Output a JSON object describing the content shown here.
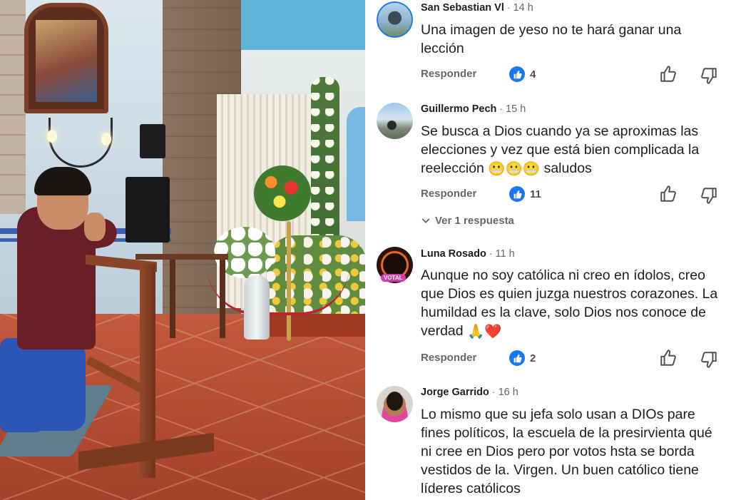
{
  "photo": {
    "description_icon": "photo-icon"
  },
  "comments": [
    {
      "author": "San Sebastian Vl",
      "time": "14 h",
      "text": "Una imagen de yeso no te hará ganar una lección",
      "reply_label": "Responder",
      "like_count": "4",
      "avatar_icon": "avatar-photo-icon"
    },
    {
      "author": "Guillermo Pech",
      "time": "15 h",
      "text_before": "Se busca a Dios cuando ya se aproximas las elecciones y vez que está bien complicada la reelección",
      "emojis": "😬😬😬",
      "text_after": "saludos",
      "reply_label": "Responder",
      "like_count": "11",
      "see_replies_label": "Ver 1 respuesta",
      "avatar_icon": "avatar-photo-icon"
    },
    {
      "author": "Luna Rosado",
      "time": "11 h",
      "text": "Aunque no soy católica ni creo en ídolos, creo que Dios es quien juzga nuestros corazones. La humildad es la clave, solo Dios nos conoce de verdad",
      "emojis": "🙏❤️",
      "avatar_badge": "VOTAL",
      "reply_label": "Responder",
      "like_count": "2",
      "avatar_icon": "avatar-photo-icon"
    },
    {
      "author": "Jorge Garrido",
      "time": "16 h",
      "text": "Lo mismo que su jefa solo usan a DIOs pare fines políticos, la escuela de la presirvienta qué ni cree en Dios pero por votos hsta se borda vestidos de la. Virgen. Un buen católico tiene líderes católicos",
      "avatar_icon": "avatar-photo-icon"
    }
  ],
  "colors": {
    "like_blue": "#1877f2",
    "secondary_text": "#65676b",
    "primary_text": "#1c1e21"
  }
}
